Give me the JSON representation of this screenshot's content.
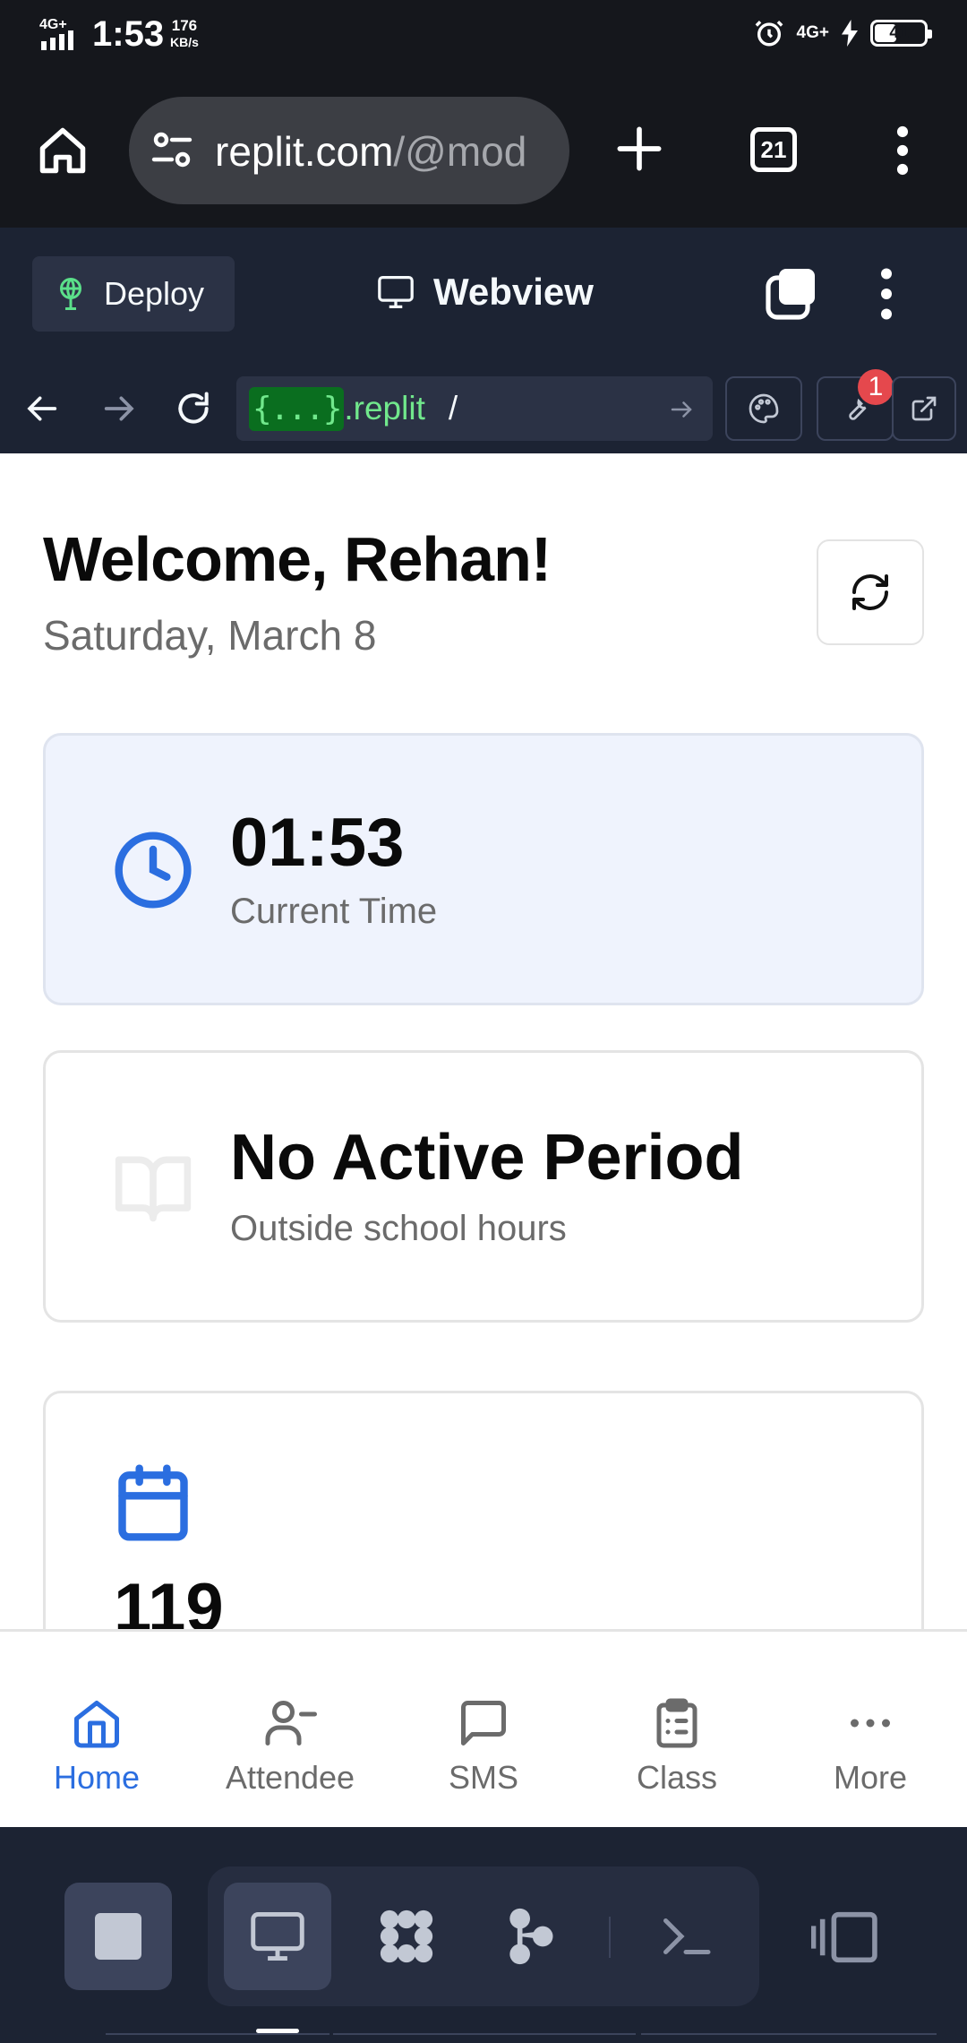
{
  "status_bar": {
    "time": "1:53",
    "speed_value": "176",
    "speed_unit": "KB/s",
    "network": "4G+",
    "signal_label": "4G+",
    "battery": "41",
    "icons": [
      "signal-icon",
      "alarm-icon",
      "charging-icon",
      "battery-icon"
    ]
  },
  "browser": {
    "url_main": "replit.com",
    "url_rest": "/@mod",
    "tab_count": "21",
    "icons": [
      "home-icon",
      "site-settings-icon",
      "new-tab-icon",
      "tabs-icon",
      "overflow-menu-icon"
    ]
  },
  "replit_header": {
    "deploy_label": "Deploy",
    "webview_label": "Webview"
  },
  "webview_nav": {
    "code_chip": "{...}",
    "domain": ".replit",
    "path": "/",
    "badge_count": "1"
  },
  "app": {
    "welcome": "Welcome, Rehan!",
    "date": "Saturday, March 8",
    "time_card": {
      "value": "01:53",
      "label": "Current Time"
    },
    "period_card": {
      "value": "No Active Period",
      "label": "Outside school hours"
    },
    "calendar_card": {
      "value": "119"
    },
    "nav": [
      {
        "label": "Home",
        "icon": "home-icon",
        "active": true
      },
      {
        "label": "Attendee",
        "icon": "user-minus-icon",
        "active": false
      },
      {
        "label": "SMS",
        "icon": "message-square-icon",
        "active": false
      },
      {
        "label": "Class",
        "icon": "clipboard-icon",
        "active": false
      },
      {
        "label": "More",
        "icon": "more-horizontal-icon",
        "active": false
      }
    ]
  },
  "colors": {
    "accent": "#2b6ee0",
    "replit_bg": "#1c2333",
    "replit_green": "#71e88c",
    "badge_red": "#e5484d"
  }
}
